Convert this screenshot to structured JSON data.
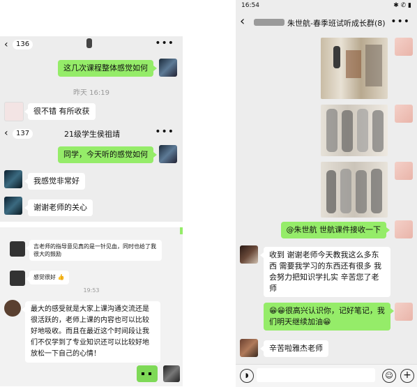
{
  "left": {
    "chat1": {
      "back_count": "136",
      "more": "•••",
      "msg_me": "这几次课程整体感觉如何",
      "time": "昨天 16:19",
      "msg_other": "很不错 有所收获"
    },
    "chat2": {
      "back_count": "137",
      "title": "21级学生侯祖靖",
      "more": "•••",
      "msg_me": "同学，今天听的感觉如何",
      "msg_other_1": "我感觉非常好",
      "msg_other_2": "谢谢老师的关心"
    },
    "chat3": {
      "msg_other_1": "吉老师的指导意见真的是一针见血，同时也给了我很大的鼓励",
      "msg_other_2": "感觉很好",
      "thumb": "👍",
      "time": "19:53",
      "msg_other_3": "最大的感受就是大家上课沟通交流还是很活跃的，老师上课的内容也可以比较好地吸收。而且在最近这个时间段让我们不仅学到了专业知识还可以比较好地放松一下自己的心情！"
    }
  },
  "right": {
    "status": {
      "time": "16:54",
      "right": "✱ ✆ ▮"
    },
    "header": {
      "back": "‹",
      "title": "朱世航-春季班试听成长群(8)",
      "more": "•••"
    },
    "messages": {
      "mention": "@朱世航  世航课件接收一下",
      "reply": "收到   谢谢老师今天教我这么多东西  需要我学习的东西还有很多  我会努力把知识学扎实   辛苦您了老师",
      "me_emoji": "😁😁",
      "me_text": "很高兴认识你，记好笔记，我们明天继续加油",
      "me_tail": "😁",
      "other_last": "辛苦啦雅杰老师"
    },
    "input": {
      "voice_icon": "voice-icon",
      "emoji_icon": "smile-icon",
      "plus_icon": "plus-icon"
    }
  },
  "colors": {
    "bubble_me": "#95ec69",
    "bg": "#ededed"
  }
}
